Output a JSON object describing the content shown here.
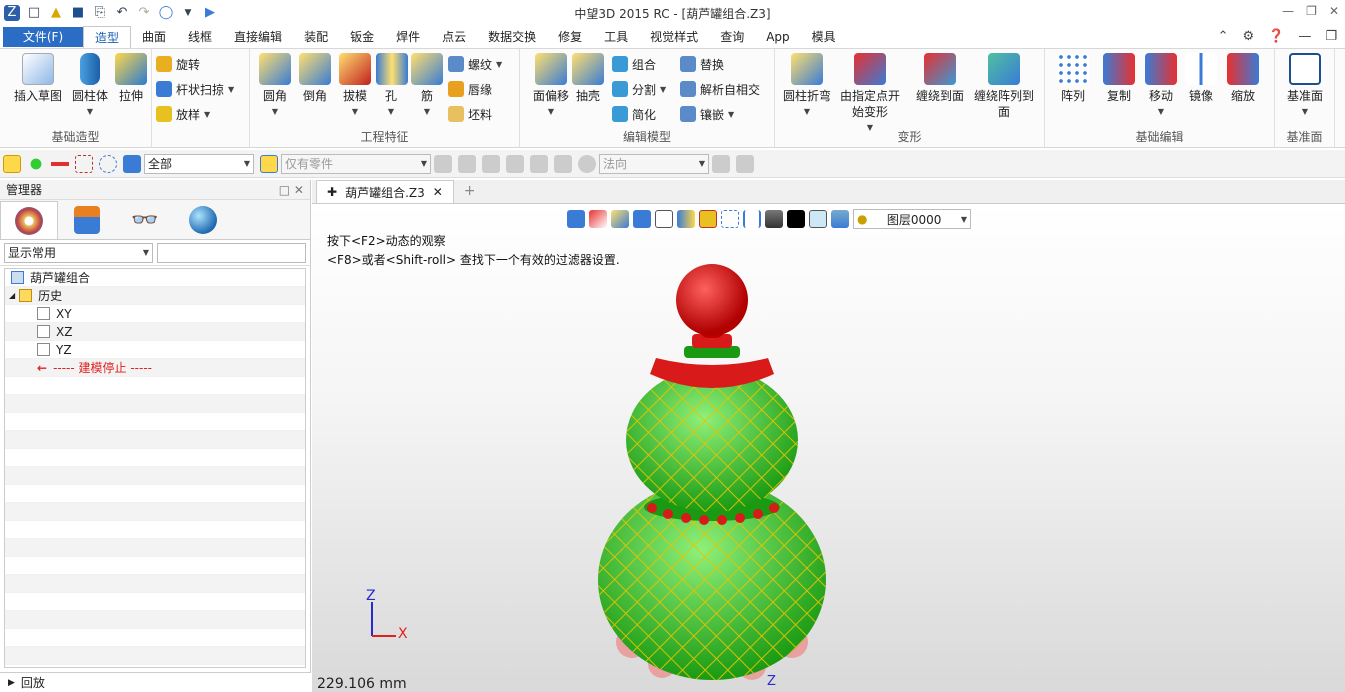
{
  "window": {
    "title": "中望3D 2015 RC - [葫芦罐组合.Z3]"
  },
  "menu_tabs": [
    {
      "label": "文件(F)"
    },
    {
      "label": "造型",
      "active": true
    },
    {
      "label": "曲面"
    },
    {
      "label": "线框"
    },
    {
      "label": "直接编辑"
    },
    {
      "label": "装配"
    },
    {
      "label": "钣金"
    },
    {
      "label": "焊件"
    },
    {
      "label": "点云"
    },
    {
      "label": "数据交换"
    },
    {
      "label": "修复"
    },
    {
      "label": "工具"
    },
    {
      "label": "视觉样式"
    },
    {
      "label": "查询"
    },
    {
      "label": "App"
    },
    {
      "label": "模具"
    }
  ],
  "ribbon": {
    "groups": [
      {
        "label": "基础造型",
        "big": [
          "插入草图",
          "圆柱体",
          "拉伸"
        ],
        "small": [
          "旋转",
          "杆状扫掠",
          "放样"
        ]
      },
      {
        "label": "工程特征",
        "big": [
          "圆角",
          "倒角",
          "拔模",
          "孔",
          "筋"
        ],
        "small": [
          "螺纹",
          "唇缘",
          "坯料"
        ]
      },
      {
        "label": "编辑模型",
        "big": [
          "面偏移",
          "抽壳"
        ],
        "small": [
          "组合",
          "分割",
          "简化",
          "替换",
          "解析自相交",
          "镶嵌"
        ]
      },
      {
        "label": "变形",
        "big": [
          "圆柱折弯",
          "由指定点开始变形",
          "缠绕到面",
          "缠绕阵列到面"
        ]
      },
      {
        "label": "基础编辑",
        "big": [
          "阵列",
          "复制",
          "移动",
          "镜像",
          "缩放"
        ]
      },
      {
        "label": "基准面",
        "big": [
          "基准面"
        ]
      }
    ]
  },
  "toolbar2": {
    "filter_value": "全部",
    "parts_placeholder": "仅有零件",
    "direction_placeholder": "法向"
  },
  "manager": {
    "title": "管理器",
    "display_filter": "显示常用",
    "tree": [
      {
        "label": "葫芦罐组合",
        "level": 0
      },
      {
        "label": "历史",
        "level": 0
      },
      {
        "label": "XY",
        "level": 2
      },
      {
        "label": "XZ",
        "level": 2
      },
      {
        "label": "YZ",
        "level": 2
      },
      {
        "label": "----- 建模停止 -----",
        "level": 2
      }
    ],
    "playback": "回放"
  },
  "doc_tab": {
    "label": "葫芦罐组合.Z3"
  },
  "viewport": {
    "layer": "图层0000",
    "hint_line1": "按下<F2>动态的观察",
    "hint_line2": "<F8>或者<Shift-roll> 查找下一个有效的过滤器设置.",
    "coordinate": "229.106 mm",
    "axis_z": "Z",
    "axis_x": "X",
    "axis_z_bottom": "Z"
  },
  "colors": {
    "accent": "#2b6cc4",
    "model_green": "#33cc22",
    "model_red": "#d81a1a",
    "model_gold": "#e6c400",
    "feet": "#e8a0a0"
  }
}
